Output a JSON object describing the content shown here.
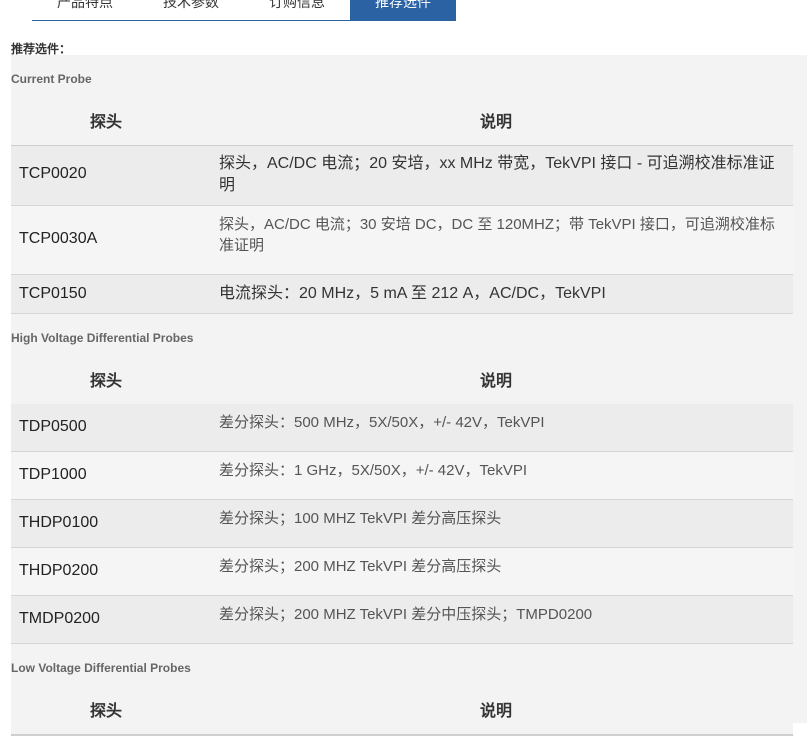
{
  "tabs": [
    {
      "label": "产品特点",
      "active": false
    },
    {
      "label": "技术参数",
      "active": false
    },
    {
      "label": "订购信息",
      "active": false
    },
    {
      "label": "推荐选件",
      "active": true
    }
  ],
  "colors": {
    "accent": "#2b62a4",
    "panel": "#f3f3f3"
  },
  "lead_label": "推荐选件：",
  "sections": [
    {
      "title": "Current Probe",
      "col_model": "探头",
      "col_desc": "说明",
      "rows": [
        {
          "model": "TCP0020",
          "desc": "探头，AC/DC 电流；20 安培，xx MHz 带宽，TekVPI 接口 - 可追溯校准标准证明"
        },
        {
          "model": "TCP0030A",
          "desc": "探头，AC/DC 电流；30 安培 DC，DC 至 120MHZ；带 TekVPI 接口，可追溯校准标准证明"
        },
        {
          "model": "TCP0150",
          "desc": "电流探头：20 MHz，5 mA 至 212 A，AC/DC，TekVPI"
        }
      ]
    },
    {
      "title": "High Voltage Differential Probes",
      "col_model": "探头",
      "col_desc": "说明",
      "rows": [
        {
          "model": "TDP0500",
          "desc": "差分探头：500 MHz，5X/50X，+/- 42V，TekVPI"
        },
        {
          "model": "TDP1000",
          "desc": "差分探头：1 GHz，5X/50X，+/- 42V，TekVPI"
        },
        {
          "model": "THDP0100",
          "desc": "差分探头；100 MHZ TekVPI 差分高压探头"
        },
        {
          "model": "THDP0200",
          "desc": "差分探头；200 MHZ TekVPI 差分高压探头"
        },
        {
          "model": "TMDP0200",
          "desc": "差分探头；200 MHZ TekVPI 差分中压探头；TMPD0200"
        }
      ]
    },
    {
      "title": "Low Voltage Differential Probes",
      "col_model": "探头",
      "col_desc": "说明",
      "rows": []
    }
  ]
}
